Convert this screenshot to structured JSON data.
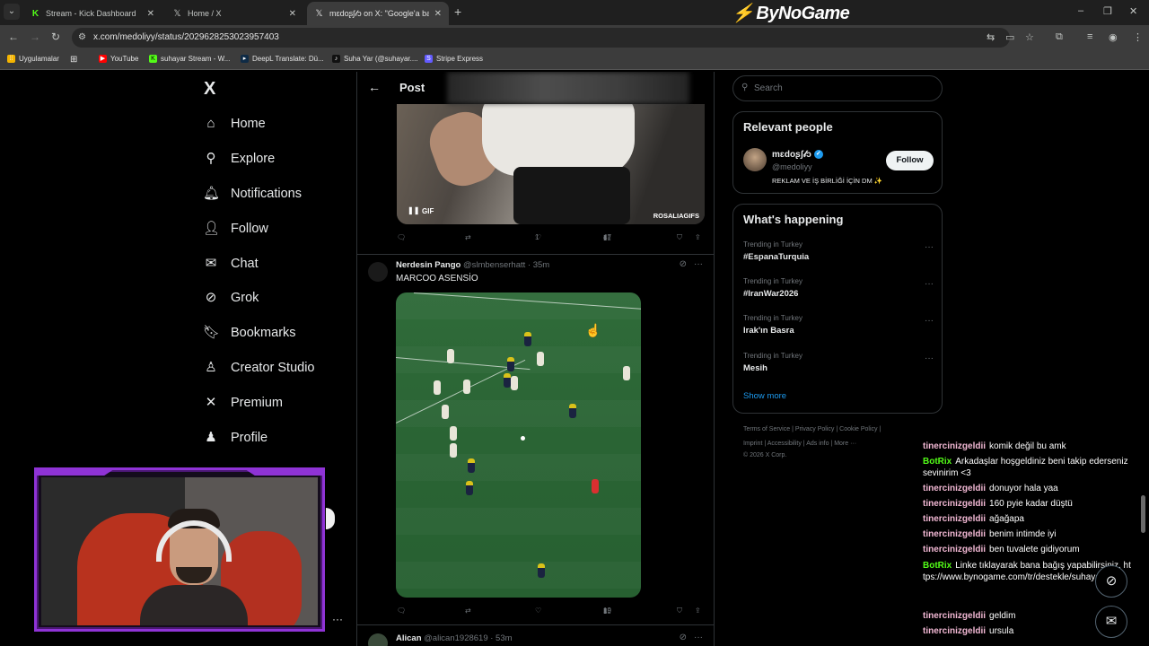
{
  "browser": {
    "tabs": [
      {
        "title": "Stream - Kick Dashboard",
        "icon": "kick-icon",
        "color": "#53fc18"
      },
      {
        "title": "Home / X",
        "icon": "x-icon",
        "color": "#ffffff"
      },
      {
        "title": "mɛdoʂʃ𝓁ɔ on X: \"Google'a bakın",
        "icon": "x-icon",
        "color": "#ffffff",
        "active": true
      }
    ],
    "url": "x.com/medoliyy/status/2029628253023957403",
    "overlay_brand": "ByNoGame",
    "bookmarks": [
      {
        "label": "Uygulamalar",
        "icon": "apps-grid-icon",
        "color": "#f4b400"
      },
      {
        "label": "YouTube",
        "icon": "youtube-icon",
        "color": "#ff0000"
      },
      {
        "label": "suhayar Stream - W...",
        "icon": "kick-icon",
        "color": "#53fc18"
      },
      {
        "label": "DeepL Translate: Dü...",
        "icon": "deepl-icon",
        "color": "#0f2b46"
      },
      {
        "label": "Suha Yar (@suhayar....",
        "icon": "tiktok-icon",
        "color": "#111111"
      },
      {
        "label": "Stripe Express",
        "icon": "stripe-icon",
        "color": "#635bff"
      }
    ]
  },
  "nav": {
    "logo": "X",
    "items": [
      {
        "label": "Home",
        "icon": "home-icon",
        "glyph": "⌂"
      },
      {
        "label": "Explore",
        "icon": "search-icon",
        "glyph": "⚲"
      },
      {
        "label": "Notifications",
        "icon": "bell-icon",
        "glyph": "🔔︎"
      },
      {
        "label": "Follow",
        "icon": "person-plus-icon",
        "glyph": "👤︎"
      },
      {
        "label": "Chat",
        "icon": "mail-icon",
        "glyph": "✉"
      },
      {
        "label": "Grok",
        "icon": "grok-icon",
        "glyph": "⊘"
      },
      {
        "label": "Bookmarks",
        "icon": "bookmark-icon",
        "glyph": "🔖︎"
      },
      {
        "label": "Creator Studio",
        "icon": "creator-studio-icon",
        "glyph": "♙"
      },
      {
        "label": "Premium",
        "icon": "x-premium-icon",
        "glyph": "✕"
      },
      {
        "label": "Profile",
        "icon": "person-icon",
        "glyph": "♟"
      }
    ]
  },
  "post": {
    "header_title": "Post",
    "gif": {
      "badge": "GIF",
      "watermark": "ROSALIAGIFS"
    },
    "first_actions": {
      "replies": "",
      "reposts": "",
      "likes": "1",
      "views": "47"
    },
    "tweets": [
      {
        "name": "Nerdesin Pango",
        "handle": "@slmbenserhatt",
        "time": "· 35m",
        "text": "MARCOO ASENSİO",
        "actions": {
          "replies": "",
          "reposts": "",
          "likes": "",
          "views": "19"
        }
      },
      {
        "name": "Alican",
        "handle": "@alican1928619",
        "time": "· 53m",
        "text": ""
      }
    ]
  },
  "sidebar": {
    "search_placeholder": "Search",
    "relevant": {
      "title": "Relevant people",
      "name": "mɛdoʂʃ𝓁ɔ",
      "handle": "@medoliyy",
      "bio": "REKLAM VE İŞ BİRLİĞİ İÇİN DM ✨",
      "follow_label": "Follow"
    },
    "happening": {
      "title": "What's happening",
      "trends": [
        {
          "context": "Trending in Turkey",
          "name": "#EspanaTurquia"
        },
        {
          "context": "Trending in Turkey",
          "name": "#IranWar2026"
        },
        {
          "context": "Trending in Turkey",
          "name": "Irak'ın Basra"
        },
        {
          "context": "Trending in Turkey",
          "name": "Mesih"
        }
      ],
      "show_more": "Show more"
    },
    "footer": {
      "line1": [
        "Terms of Service",
        "Privacy Policy",
        "Cookie Policy"
      ],
      "line2": [
        "Imprint",
        "Accessibility",
        "Ads info",
        "More ···"
      ],
      "copyright": "© 2026 X Corp."
    }
  },
  "chat": {
    "messages": [
      {
        "user": "tinercinizgeldii",
        "text": "komik değil bu amk",
        "color": "#f2b8d4"
      },
      {
        "user": "BotRix",
        "text": "Arkadaşlar hoşgeldiniz beni takip ederseniz sevinirim <3",
        "color": "#53fc18"
      },
      {
        "user": "tinercinizgeldii",
        "text": "donuyor hala yaa",
        "color": "#f2b8d4"
      },
      {
        "user": "tinercinizgeldii",
        "text": "160 pyie kadar düştü",
        "color": "#f2b8d4"
      },
      {
        "user": "tinercinizgeldii",
        "text": "ağağapa",
        "color": "#f2b8d4"
      },
      {
        "user": "tinercinizgeldii",
        "text": "benim intimde iyi",
        "color": "#f2b8d4"
      },
      {
        "user": "tinercinizgeldii",
        "text": "ben tuvalete gidiyorum",
        "color": "#f2b8d4"
      },
      {
        "user": "BotRix",
        "text": "Linke tıklayarak bana bağış yapabilirsiniz. https://www.bynogame.com/tr/destekle/suhayar",
        "color": "#53fc18"
      },
      {
        "user": "tinercinizgeldii",
        "text": "geldim",
        "color": "#f2b8d4"
      },
      {
        "user": "tinercinizgeldii",
        "text": "ursula",
        "color": "#f2b8d4"
      }
    ]
  }
}
